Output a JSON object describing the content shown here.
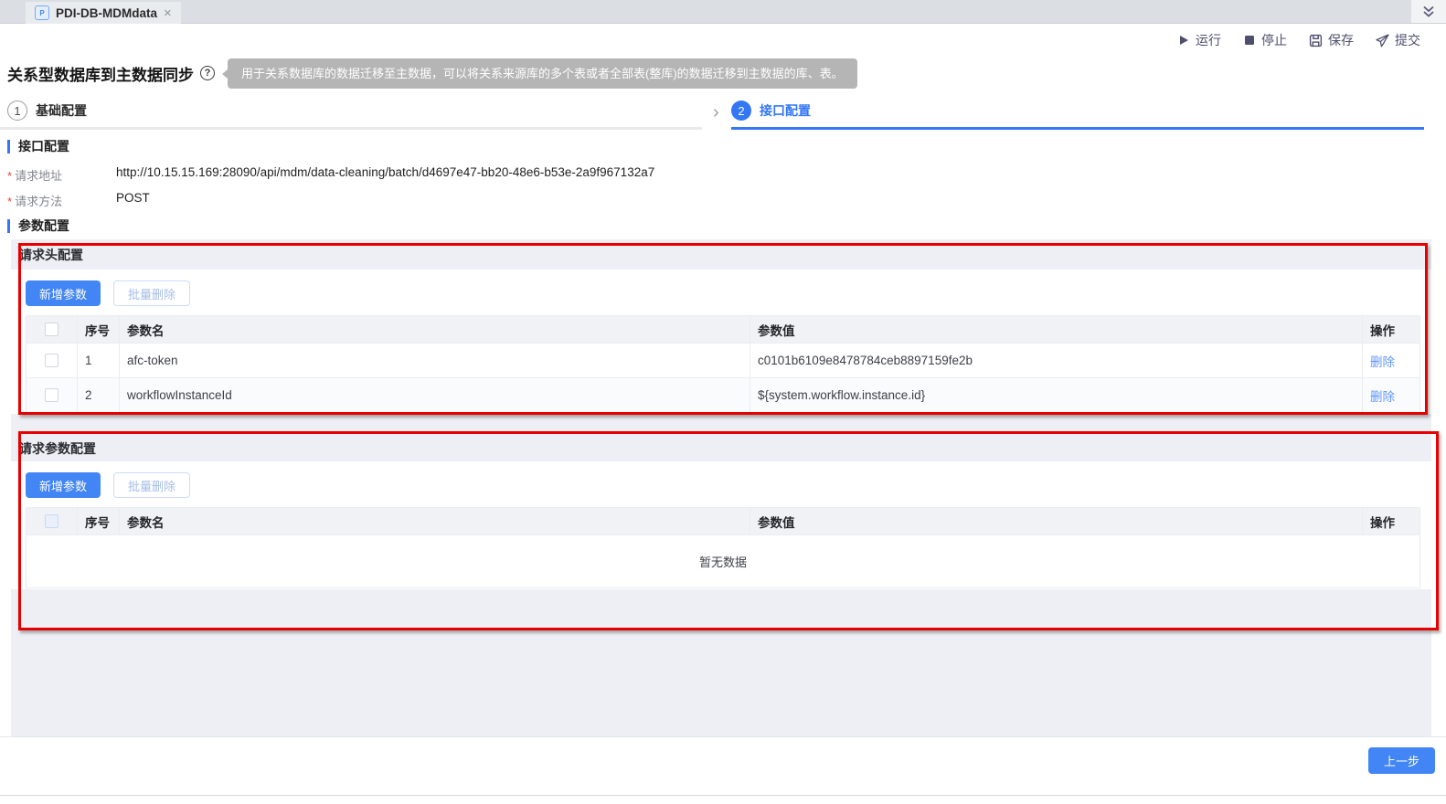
{
  "tab_bar": {
    "active_tab_label": "PDI-DB-MDMdata",
    "close_glyph": "×",
    "icon_letter": "P",
    "collapse_icon": "double-chevron-down"
  },
  "toolbar": {
    "run_label": "运行",
    "stop_label": "停止",
    "save_label": "保存",
    "submit_label": "提交"
  },
  "page": {
    "title": "关系型数据库到主数据同步",
    "help_glyph": "?",
    "tooltip": "用于关系数据库的数据迁移至主数据，可以将关系来源库的多个表或者全部表(整库)的数据迁移到主数据的库、表。"
  },
  "steps": {
    "arrow_glyph": "›",
    "items": [
      {
        "num": "1",
        "label": "基础配置"
      },
      {
        "num": "2",
        "label": "接口配置"
      }
    ]
  },
  "interface_section": {
    "title": "接口配置",
    "required_mark": "*",
    "request_url_label": "请求地址",
    "request_url_value": "http://10.15.15.169:28090/api/mdm/data-cleaning/batch/d4697e47-bb20-48e6-b53e-2a9f967132a7",
    "request_method_label": "请求方法",
    "request_method_value": "POST"
  },
  "params_section": {
    "title": "参数配置",
    "header_panel": {
      "title": "请求头配置",
      "add_button": "新增参数",
      "batch_delete_button": "批量删除",
      "columns": {
        "index": "序号",
        "name": "参数名",
        "value": "参数值",
        "action": "操作"
      },
      "rows": [
        {
          "index": "1",
          "name": "afc-token",
          "value": "c0101b6109e8478784ceb8897159fe2b",
          "action": "删除"
        },
        {
          "index": "2",
          "name": "workflowInstanceId",
          "value": "${system.workflow.instance.id}",
          "action": "删除"
        }
      ]
    },
    "request_panel": {
      "title": "请求参数配置",
      "add_button": "新增参数",
      "batch_delete_button": "批量删除",
      "columns": {
        "index": "序号",
        "name": "参数名",
        "value": "参数值",
        "action": "操作"
      },
      "empty_text": "暂无数据"
    }
  },
  "footer": {
    "prev_button": "上一步"
  },
  "colors": {
    "accent_blue": "#4285f4",
    "step_active_blue": "#3377f6",
    "annotation_red": "#e60000",
    "link_blue": "#6097f7",
    "panel_gray": "#edeff4"
  }
}
